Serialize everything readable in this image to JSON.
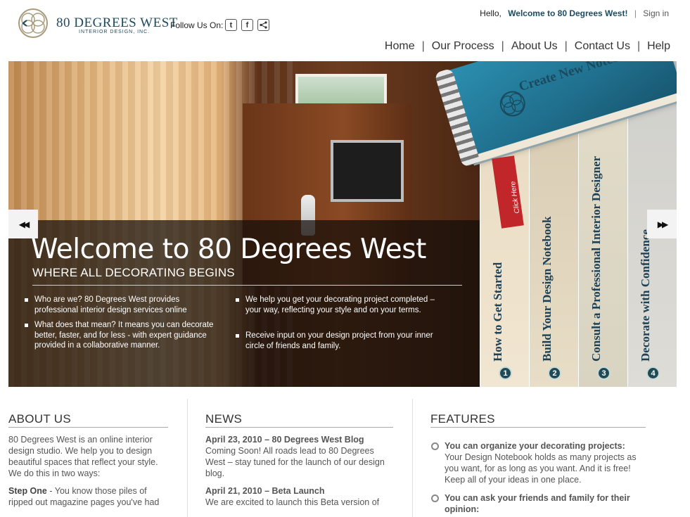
{
  "header": {
    "logo_name": "80 DEGREES WEST",
    "logo_sub": "INTERIOR DESIGN, INC.",
    "follow_label": "Follow Us On:",
    "social_icons": [
      "twitter-icon",
      "facebook-icon",
      "share-icon"
    ],
    "hello": "Hello,",
    "welcome": "Welcome to 80 Degrees West!",
    "signin": "Sign in"
  },
  "nav": {
    "items": [
      "Home",
      "Our Process",
      "About Us",
      "Contact Us",
      "Help"
    ],
    "separator": "|"
  },
  "hero": {
    "title": "Welcome to 80 Degrees West",
    "subtitle": "WHERE ALL DECORATING BEGINS",
    "bullets_left": [
      "Who are we?  80 Degrees West provides professional interior design services online",
      "What does that mean? It means you can decorate better, faster, and for less - with expert guidance provided in a collaborative manner."
    ],
    "bullets_right": [
      "We help you get your decorating project completed – your way, reflecting your style and on your terms.",
      "Receive input on your design project from your inner circle of friends and family."
    ],
    "prev_arrow": "◀◀",
    "next_arrow": "▶▶",
    "notebook_label": "Create New Notebook",
    "bookmark_label": "Click Here",
    "steps": [
      {
        "num": "1",
        "label": "How to Get Started"
      },
      {
        "num": "2",
        "label": "Build Your Design Notebook"
      },
      {
        "num": "3",
        "label": "Consult a Professional Interior Designer"
      },
      {
        "num": "4",
        "label": "Decorate with Confidence"
      }
    ]
  },
  "about": {
    "heading": "ABOUT US",
    "intro": "80 Degrees West is an online interior design studio. We help you to design beautiful spaces that reflect your style. We do this in two ways:",
    "step_one_label": "Step One",
    "step_one_text": " - You know those piles of ripped out magazine pages you've had"
  },
  "news": {
    "heading": "NEWS",
    "items": [
      {
        "title": "April 23, 2010 – 80 Degrees West Blog",
        "text": "Coming Soon! All roads lead to 80 Degrees West – stay tuned for the launch of our design blog."
      },
      {
        "title": "April 21, 2010 – Beta Launch",
        "text": "We are excited to launch this Beta version of"
      }
    ]
  },
  "features": {
    "heading": "FEATURES",
    "items": [
      {
        "title": "You can organize your decorating projects:",
        "text": "Your Design Notebook holds as many projects as you want, for as long as you want. And it is free! Keep all of your ideas in one place."
      },
      {
        "title": "You can ask your friends and family for their opinion:",
        "text": ""
      }
    ]
  },
  "colors": {
    "brand_teal": "#1d4b60",
    "accent_red": "#c0262a"
  }
}
